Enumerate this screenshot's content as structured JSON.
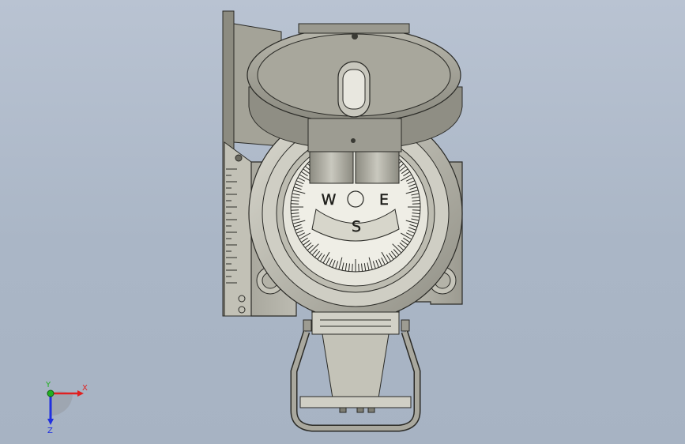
{
  "viewport": {
    "model": "compass",
    "background_top": "#b9c3d2",
    "background_bottom": "#a7b3c3"
  },
  "dial": {
    "letters": {
      "west": "W",
      "east": "E",
      "south": "S"
    }
  },
  "triad": {
    "x_label": "X",
    "y_label": "Y",
    "z_label": "Z",
    "x_color": "#e02020",
    "y_color": "#20b020",
    "z_color": "#2030e0"
  },
  "colors": {
    "body": "#c9c8bd",
    "body_dark": "#7c7b71",
    "lid": "#a9a89d",
    "edge": "#2a2a26"
  }
}
